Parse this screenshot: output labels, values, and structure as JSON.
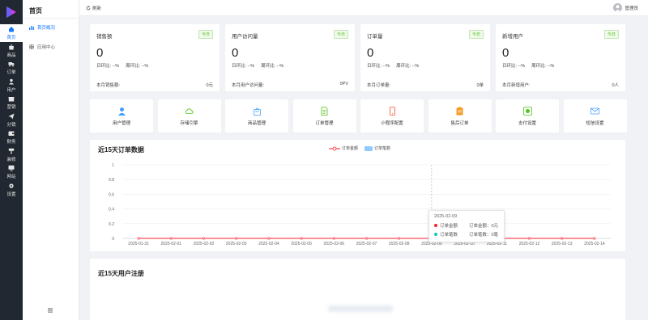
{
  "sidebar": {
    "items": [
      {
        "label": "首页",
        "icon": "home-icon",
        "active": true
      },
      {
        "label": "商品",
        "icon": "bag-icon"
      },
      {
        "label": "订单",
        "icon": "truck-icon"
      },
      {
        "label": "用户",
        "icon": "user-icon"
      },
      {
        "label": "营销",
        "icon": "gift-icon"
      },
      {
        "label": "分销",
        "icon": "send-icon"
      },
      {
        "label": "财务",
        "icon": "wallet-icon"
      },
      {
        "label": "装修",
        "icon": "paint-icon"
      },
      {
        "label": "网站",
        "icon": "monitor-icon"
      },
      {
        "label": "设置",
        "icon": "gear-icon"
      }
    ]
  },
  "subsidebar": {
    "title": "首页",
    "items": [
      {
        "label": "首页概况",
        "active": true
      },
      {
        "label": "应用中心"
      }
    ]
  },
  "topbar": {
    "refresh_label": "刷新",
    "user_label": "管理员"
  },
  "stats": [
    {
      "title": "销售额",
      "badge": "今日",
      "value": "0",
      "day_ratio": "日环比: --%",
      "week_ratio": "周环比: --%",
      "foot_label": "本月销售额:",
      "foot_value": "0元"
    },
    {
      "title": "用户访问量",
      "badge": "今日",
      "value": "0",
      "day_ratio": "日环比: --%",
      "week_ratio": "周环比: --%",
      "foot_label": "本月用户访问量:",
      "foot_value": "0PV"
    },
    {
      "title": "订单量",
      "badge": "今日",
      "value": "0",
      "day_ratio": "日环比: --%",
      "week_ratio": "周环比: --%",
      "foot_label": "本月订单量:",
      "foot_value": "0单"
    },
    {
      "title": "新增用户",
      "badge": "今日",
      "value": "0",
      "day_ratio": "日环比: --%",
      "week_ratio": "周环比: --%",
      "foot_label": "本月新增用户:",
      "foot_value": "0人"
    }
  ],
  "tiles": [
    {
      "label": "用户管理",
      "icon": "user-icon",
      "color": "#409eff"
    },
    {
      "label": "存储引擎",
      "icon": "cloud-icon",
      "color": "#52c41a"
    },
    {
      "label": "商品管理",
      "icon": "bag-icon",
      "color": "#409eff"
    },
    {
      "label": "订单管理",
      "icon": "document-icon",
      "color": "#52c41a"
    },
    {
      "label": "小程序配置",
      "icon": "phone-icon",
      "color": "#f5532d"
    },
    {
      "label": "售后订单",
      "icon": "clipboard-icon",
      "color": "#f59a23"
    },
    {
      "label": "支付设置",
      "icon": "wechat-pay-icon",
      "color": "#52c41a"
    },
    {
      "label": "短信设置",
      "icon": "mail-icon",
      "color": "#409eff"
    }
  ],
  "order_chart": {
    "title": "近15天订单数据",
    "tooltip": {
      "date": "2025-02-09",
      "rows": [
        {
          "name": "订单金额",
          "value": "订单金额：0元",
          "color": "#f5222d"
        },
        {
          "name": "订单笔数",
          "value": "订单笔数：0笔",
          "color": "#13c2c2"
        }
      ]
    }
  },
  "register_chart": {
    "title": "近15天用户注册"
  },
  "chart_data": {
    "type": "line",
    "title": "近15天订单数据",
    "categories": [
      "2025-01-31",
      "2025-02-01",
      "2025-02-02",
      "2025-02-03",
      "2025-02-04",
      "2025-02-05",
      "2025-02-06",
      "2025-02-07",
      "2025-02-08",
      "2025-02-09",
      "2025-02-10",
      "2025-02-11",
      "2025-02-12",
      "2025-02-13",
      "2025-02-14"
    ],
    "y_ticks": [
      "0",
      "0.2",
      "0.4",
      "0.6",
      "0.8",
      "1"
    ],
    "ylim": [
      0,
      1
    ],
    "grid": true,
    "legend_position": "top-center",
    "highlighted_category": "2025-02-09",
    "series": [
      {
        "name": "订单金额",
        "type": "line",
        "color": "#f5222d",
        "values": [
          0,
          0,
          0,
          0,
          0,
          0,
          0,
          0,
          0,
          0,
          0,
          0,
          0,
          0,
          0
        ]
      },
      {
        "name": "订单笔数",
        "type": "bar",
        "color": "#91caff",
        "values": [
          0,
          0,
          0,
          0,
          0,
          0,
          0,
          0,
          0,
          0,
          0,
          0,
          0,
          0,
          0
        ]
      }
    ]
  }
}
